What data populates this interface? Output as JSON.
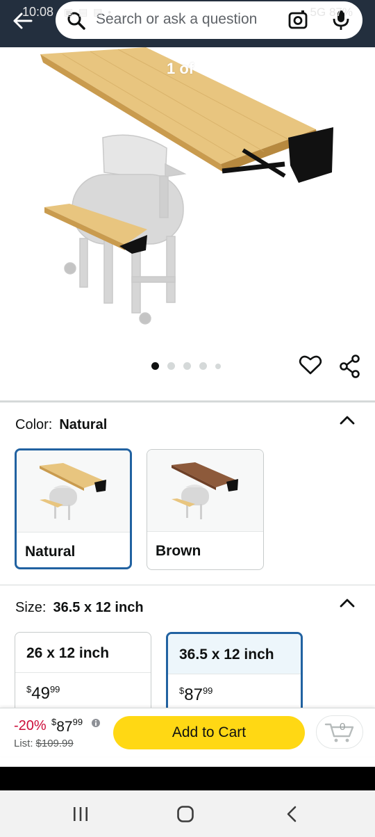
{
  "status_bar": {
    "time": "10:08",
    "battery": "87%",
    "network": "5G"
  },
  "search": {
    "placeholder": "Search or ask a question"
  },
  "gallery": {
    "counter": "1 of",
    "total_dots": 5,
    "active_index": 0
  },
  "color_section": {
    "label": "Color:",
    "selected": "Natural",
    "options": [
      {
        "label": "Natural",
        "color": "#e7c47c",
        "selected": true
      },
      {
        "label": "Brown",
        "color": "#8d5a3b",
        "selected": false
      }
    ]
  },
  "size_section": {
    "label": "Size:",
    "selected": "36.5 x 12 inch",
    "options": [
      {
        "label": "26 x 12 inch",
        "price_symbol": "$",
        "price_whole": "49",
        "price_fraction": "99",
        "selected": false
      },
      {
        "label": "36.5 x 12 inch",
        "price_symbol": "$",
        "price_whole": "87",
        "price_fraction": "99",
        "selected": true
      }
    ]
  },
  "buy_bar": {
    "discount": "-20%",
    "price_symbol": "$",
    "price_whole": "87",
    "price_fraction": "99",
    "list_label": "List:",
    "list_price": "$109.99",
    "add_to_cart_label": "Add to Cart",
    "cart_count": "0"
  },
  "colors": {
    "header_bg": "#232f3e",
    "accent_yellow": "#ffd814",
    "selected_border": "#2162a1",
    "discount_red": "#cc0c39"
  }
}
